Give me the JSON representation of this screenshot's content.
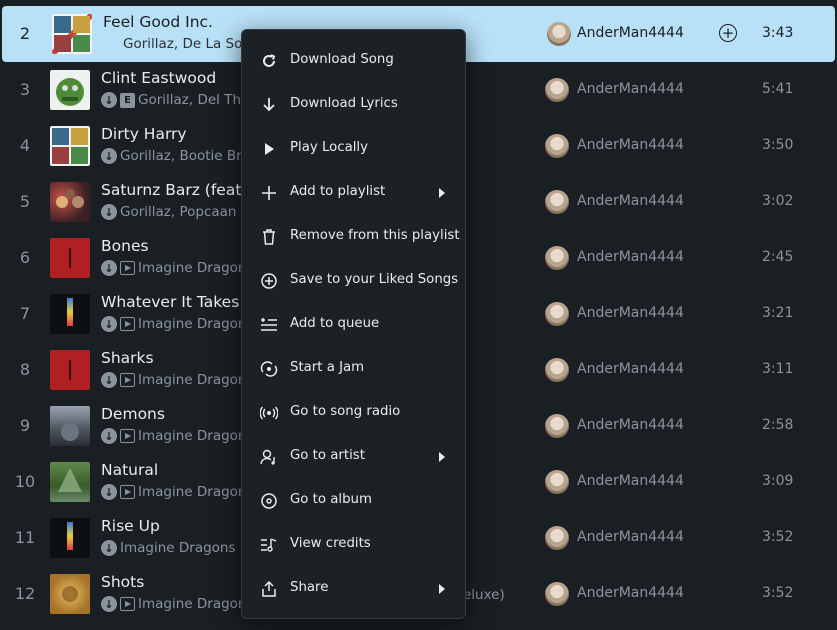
{
  "tracks": [
    {
      "num": "2",
      "title": "Feel Good Inc.",
      "artist": "Gorillaz, De La Soul",
      "album": "",
      "user": "AnderMan4444",
      "duration": "3:43",
      "selected": true
    },
    {
      "num": "3",
      "title": "Clint Eastwood",
      "artist": "Gorillaz, Del The",
      "album": "",
      "user": "AnderMan4444",
      "duration": "5:41",
      "explicit": "E"
    },
    {
      "num": "4",
      "title": "Dirty Harry",
      "artist": "Gorillaz, Bootie Bro",
      "album": "",
      "user": "AnderMan4444",
      "duration": "3:50"
    },
    {
      "num": "5",
      "title": "Saturnz Barz (feat. P",
      "artist": "Gorillaz, Popcaan",
      "album": "",
      "user": "AnderMan4444",
      "duration": "3:02"
    },
    {
      "num": "6",
      "title": "Bones",
      "artist": "Imagine Dragon",
      "album": "",
      "user": "AnderMan4444",
      "duration": "2:45",
      "video": true
    },
    {
      "num": "7",
      "title": "Whatever It Takes",
      "artist": "Imagine Dragon",
      "album": "",
      "user": "AnderMan4444",
      "duration": "3:21",
      "video": true
    },
    {
      "num": "8",
      "title": "Sharks",
      "artist": "Imagine Dragon",
      "album": "",
      "user": "AnderMan4444",
      "duration": "3:11",
      "video": true
    },
    {
      "num": "9",
      "title": "Demons",
      "artist": "Imagine Dragon",
      "album": "",
      "user": "AnderMan4444",
      "duration": "2:58",
      "video": true
    },
    {
      "num": "10",
      "title": "Natural",
      "artist": "Imagine Dragon",
      "album": "",
      "user": "AnderMan4444",
      "duration": "3:09",
      "video": true
    },
    {
      "num": "11",
      "title": "Rise Up",
      "artist": "Imagine Dragons",
      "album": "",
      "user": "AnderMan4444",
      "duration": "3:52"
    },
    {
      "num": "12",
      "title": "Shots",
      "artist": "Imagine Dragon",
      "album": "eluxe)",
      "user": "AnderMan4444",
      "duration": "3:52",
      "video": true
    }
  ],
  "menu": [
    {
      "label": "Download Song",
      "icon": "download-circle-icon"
    },
    {
      "label": "Download Lyrics",
      "icon": "arrow-down-icon"
    },
    {
      "label": "Play Locally",
      "icon": "play-icon"
    },
    {
      "label": "Add to playlist",
      "icon": "plus-icon",
      "submenu": true
    },
    {
      "label": "Remove from this playlist",
      "icon": "trash-icon"
    },
    {
      "label": "Save to your Liked Songs",
      "icon": "plus-circle-icon"
    },
    {
      "label": "Add to queue",
      "icon": "queue-icon"
    },
    {
      "label": "Start a Jam",
      "icon": "jam-icon"
    },
    {
      "label": "Go to song radio",
      "icon": "radio-icon"
    },
    {
      "label": "Go to artist",
      "icon": "artist-icon",
      "submenu": true
    },
    {
      "label": "Go to album",
      "icon": "album-icon"
    },
    {
      "label": "View credits",
      "icon": "credits-icon"
    },
    {
      "label": "Share",
      "icon": "share-icon",
      "submenu": true
    }
  ],
  "colors": {
    "background": "#1a1f24",
    "selected_row": "#b8e0f6",
    "menu_bg": "#1c2126"
  }
}
